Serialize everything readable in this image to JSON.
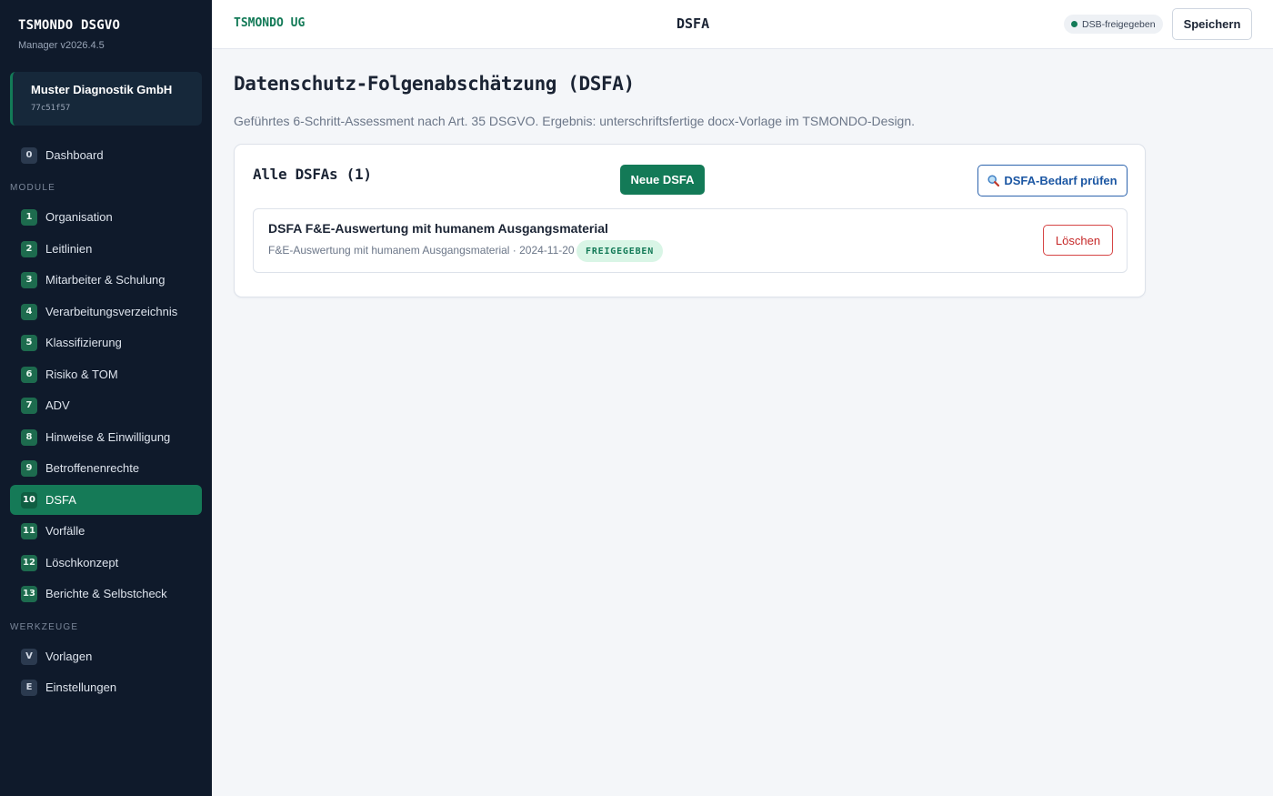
{
  "sidebar": {
    "brand_title": "TSMONDO DSGVO",
    "version": "Manager v2026.4.5",
    "tenant_name": "Muster Diagnostik GmbH",
    "tenant_id": "77c51f57",
    "dashboard": {
      "num": "0",
      "label": "Dashboard"
    },
    "module_section": "MODULE",
    "modules": [
      {
        "num": "1",
        "label": "Organisation"
      },
      {
        "num": "2",
        "label": "Leitlinien"
      },
      {
        "num": "3",
        "label": "Mitarbeiter & Schulung"
      },
      {
        "num": "4",
        "label": "Verarbeitungsverzeichnis"
      },
      {
        "num": "5",
        "label": "Klassifizierung"
      },
      {
        "num": "6",
        "label": "Risiko & TOM"
      },
      {
        "num": "7",
        "label": "ADV"
      },
      {
        "num": "8",
        "label": "Hinweise & Einwilligung"
      },
      {
        "num": "9",
        "label": "Betroffenenrechte"
      },
      {
        "num": "10",
        "label": "DSFA"
      },
      {
        "num": "11",
        "label": "Vorfälle"
      },
      {
        "num": "12",
        "label": "Löschkonzept"
      },
      {
        "num": "13",
        "label": "Berichte & Selbstcheck"
      }
    ],
    "active_module": "DSFA",
    "tools_section": "WERKZEUGE",
    "tools": [
      {
        "num": "V",
        "label": "Vorlagen"
      },
      {
        "num": "E",
        "label": "Einstellungen"
      }
    ]
  },
  "header": {
    "company": "TSMONDO UG",
    "title": "DSFA",
    "status": "DSB-freigegeben",
    "save_label": "Speichern"
  },
  "main": {
    "title": "Datenschutz-Folgenabschätzung (DSFA)",
    "description": "Geführtes 6-Schritt-Assessment nach Art. 35 DSGVO. Ergebnis: unterschriftsfertige docx-Vorlage im TSMONDO-Design.",
    "card": {
      "title": "Alle DSFAs (1)",
      "new_label": "Neue DSFA",
      "check_label": "DSFA-Bedarf prüfen",
      "entries": [
        {
          "title": "DSFA F&E-Auswertung mit humanem Ausgangsmaterial",
          "meta": "F&E-Auswertung mit humanem Ausgangsmaterial · 2024-11-20",
          "badge": "FREIGEGEBEN",
          "delete_label": "Löschen"
        }
      ]
    }
  },
  "colors": {
    "accent": "#137a57",
    "sidebar_bg": "#0f1a2b",
    "link_blue": "#1c57a3",
    "danger": "#c62828"
  }
}
